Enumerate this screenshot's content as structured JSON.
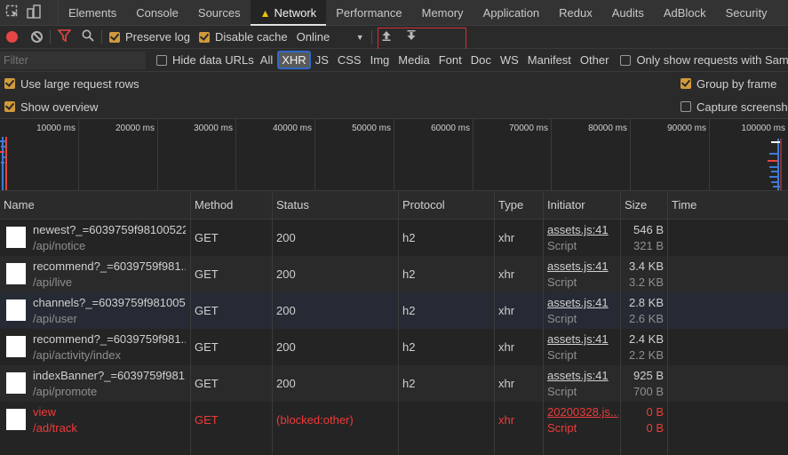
{
  "tabs": [
    "Elements",
    "Console",
    "Sources",
    "Network",
    "Performance",
    "Memory",
    "Application",
    "Redux",
    "Audits",
    "AdBlock",
    "Security"
  ],
  "active_tab": "Network",
  "toolbar": {
    "preserve_log": "Preserve log",
    "disable_cache": "Disable cache",
    "throttling": "Online"
  },
  "filter": {
    "placeholder": "Filter",
    "hide_data_urls": "Hide data URLs",
    "types": [
      "All",
      "XHR",
      "JS",
      "CSS",
      "Img",
      "Media",
      "Font",
      "Doc",
      "WS",
      "Manifest",
      "Other"
    ],
    "selected_type": "XHR",
    "samesite": "Only show requests with SameSite i"
  },
  "options": {
    "large_rows": "Use large request rows",
    "show_overview": "Show overview",
    "group_by_frame": "Group by frame",
    "capture_screenshots": "Capture screenshot"
  },
  "timeline_ticks": [
    "10000 ms",
    "20000 ms",
    "30000 ms",
    "40000 ms",
    "50000 ms",
    "60000 ms",
    "70000 ms",
    "80000 ms",
    "90000 ms",
    "100000 ms"
  ],
  "columns": [
    "Name",
    "Method",
    "Status",
    "Protocol",
    "Type",
    "Initiator",
    "Size",
    "Time"
  ],
  "rows": [
    {
      "name": "newest?_=6039759f98100522...",
      "path": "/api/notice",
      "method": "GET",
      "status": "200",
      "protocol": "h2",
      "type": "xhr",
      "initiator": "assets.js:41",
      "initiator_type": "Script",
      "size": "546 B",
      "content": "321 B"
    },
    {
      "name": "recommend?_=6039759f981...",
      "path": "/api/live",
      "method": "GET",
      "status": "200",
      "protocol": "h2",
      "type": "xhr",
      "initiator": "assets.js:41",
      "initiator_type": "Script",
      "size": "3.4 KB",
      "content": "3.2 KB"
    },
    {
      "name": "channels?_=6039759f981005...",
      "path": "/api/user",
      "method": "GET",
      "status": "200",
      "protocol": "h2",
      "type": "xhr",
      "initiator": "assets.js:41",
      "initiator_type": "Script",
      "size": "2.8 KB",
      "content": "2.6 KB"
    },
    {
      "name": "recommend?_=6039759f981...",
      "path": "/api/activity/index",
      "method": "GET",
      "status": "200",
      "protocol": "h2",
      "type": "xhr",
      "initiator": "assets.js:41",
      "initiator_type": "Script",
      "size": "2.4 KB",
      "content": "2.2 KB"
    },
    {
      "name": "indexBanner?_=6039759f981...",
      "path": "/api/promote",
      "method": "GET",
      "status": "200",
      "protocol": "h2",
      "type": "xhr",
      "initiator": "assets.js:41",
      "initiator_type": "Script",
      "size": "925 B",
      "content": "700 B"
    },
    {
      "name": "view",
      "path": "/ad/track",
      "method": "GET",
      "status": "(blocked:other)",
      "protocol": "",
      "type": "xhr",
      "initiator": "20200328.js...",
      "initiator_type": "Script",
      "size": "0 B",
      "content": "0 B"
    }
  ]
}
